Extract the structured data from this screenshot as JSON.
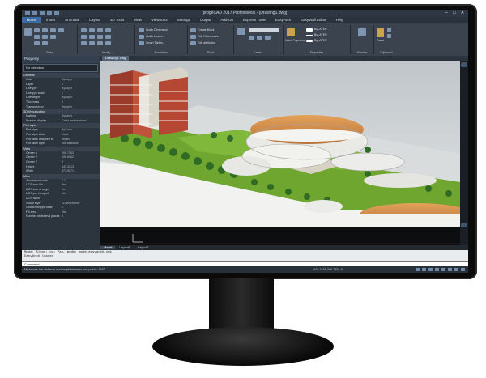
{
  "window": {
    "title": "progeCAD 2017 Professional - [Drawing1.dwg]",
    "controls": [
      "–",
      "□",
      "✕"
    ]
  },
  "menu": {
    "items": [
      "Home",
      "Insert",
      "Annotate",
      "Layout",
      "3D Tools",
      "View",
      "Viewports",
      "Settings",
      "Output",
      "Add-On",
      "Express Tools",
      "EasyArch",
      "EasyWall Editor",
      "Help"
    ],
    "active_index": 0
  },
  "ribbon": {
    "groups": [
      {
        "label": "Draw"
      },
      {
        "label": "Modify"
      },
      {
        "label": "Annotation"
      },
      {
        "label": "Block"
      },
      {
        "label": "Layers"
      },
      {
        "label": "Properties"
      },
      {
        "label": "Window"
      },
      {
        "label": "Clipboard"
      }
    ],
    "labels": {
      "quick_dimension": "Quick Dimension",
      "quick_leader": "Quick Leader",
      "smart_tables": "Smart Tables",
      "create_block": "Create Block",
      "edit_references": "Edit References",
      "edit_attributes": "Edit attributes",
      "match_properties": "Match Properties",
      "bylayer_1": "ByLAYER",
      "bylayer_2": "ByLAYER",
      "bylayer_3": "ByLAYER",
      "paste": "Paste"
    }
  },
  "properties_panel": {
    "title": "Property",
    "selector": "No selection",
    "sections": [
      {
        "name": "General",
        "rows": [
          [
            "Color",
            "ByLayer"
          ],
          [
            "Layer",
            "0"
          ],
          [
            "Linetype",
            "ByLayer"
          ],
          [
            "Linetype scale",
            "1"
          ],
          [
            "Lineweight",
            "ByLayer"
          ],
          [
            "Thickness",
            "0"
          ],
          [
            "Transparency",
            "ByLayer"
          ]
        ]
      },
      {
        "name": "3D Visualization",
        "rows": [
          [
            "Material",
            "ByLayer"
          ],
          [
            "Shadow display",
            "Casts and receives"
          ]
        ]
      },
      {
        "name": "Plot style",
        "rows": [
          [
            "Plot style",
            "ByColor"
          ],
          [
            "Plot style table",
            "None"
          ],
          [
            "Plot table attached to",
            "Model"
          ],
          [
            "Plot table type",
            "Not available"
          ]
        ]
      },
      {
        "name": "View",
        "rows": [
          [
            "Center X",
            "398.7983"
          ],
          [
            "Center Y",
            "196.8962"
          ],
          [
            "Center Z",
            "0"
          ],
          [
            "Height",
            "432.4513"
          ],
          [
            "Width",
            "872.5071"
          ]
        ]
      },
      {
        "name": "Misc",
        "rows": [
          [
            "Annotation scale",
            "1:1"
          ],
          [
            "UCS icon On",
            "Yes"
          ],
          [
            "UCS icon at origin",
            "Yes"
          ],
          [
            "UCS per viewport",
            "Yes"
          ],
          [
            "UCS Name",
            ""
          ],
          [
            "Visual style",
            "2D Wireframe"
          ],
          [
            "Global linetype scale",
            "1"
          ],
          [
            "Fill area",
            "Yes"
          ],
          [
            "Number of decimal places",
            "4"
          ]
        ]
      }
    ]
  },
  "document": {
    "tab": "Drawing1.dwg"
  },
  "layout_tabs": [
    "Model",
    "Layout1",
    "Layout2"
  ],
  "command": {
    "history_1": "Mode: Alone; ou; Pan, mode: mode-easyarch.cui",
    "history_2": "EasyArch loaded",
    "prompt": "Command:"
  },
  "status": {
    "text": "Measures the distance and angle between two points:  DIST",
    "coords": "448.2498,266.7761,0"
  }
}
